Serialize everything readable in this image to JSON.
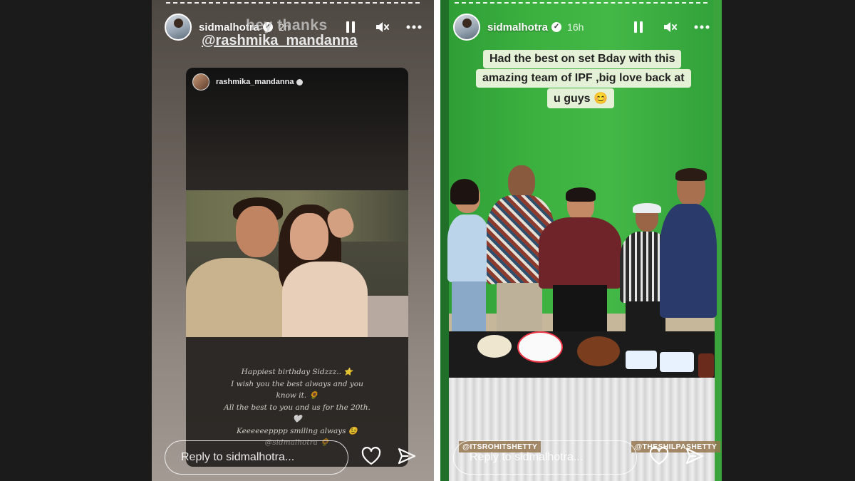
{
  "left_story": {
    "username": "sidmalhotra",
    "time": "2h",
    "sticker_text": "hey thanks",
    "mention": "@rashmika_mandanna",
    "shared_post": {
      "username": "rashmika_mandanna",
      "caption_lines": [
        "Happiest birthday Sidzzz.. ⭐",
        "I wish you the best always and you",
        "know it. 🌻",
        "All the best to you and us for the 20th.",
        "🤍",
        "Keeeeeepppp smiling always 😉",
        "@sidmalhotra 🌻"
      ]
    },
    "reply_placeholder": "Reply to sidmalhotra..."
  },
  "right_story": {
    "username": "sidmalhotra",
    "time": "16h",
    "caption_lines": [
      "Had the best on set Bday with this",
      "amazing team of IPF ,big love back at",
      "u guys 😊"
    ],
    "tags": [
      "@ITSROHITSHETTY",
      "@THESHILPASHETTY"
    ],
    "reply_placeholder": "Reply to sidmalhotra..."
  },
  "icons": {
    "pause": "pause-icon",
    "mute": "mute-icon",
    "more": "more-icon",
    "like": "heart-icon",
    "share": "send-icon",
    "verified": "verified-badge-icon"
  },
  "colors": {
    "page_bg": "#1b1b1b",
    "green_screen": "#3bb03f",
    "caption_bg": "#e5f1d6"
  }
}
